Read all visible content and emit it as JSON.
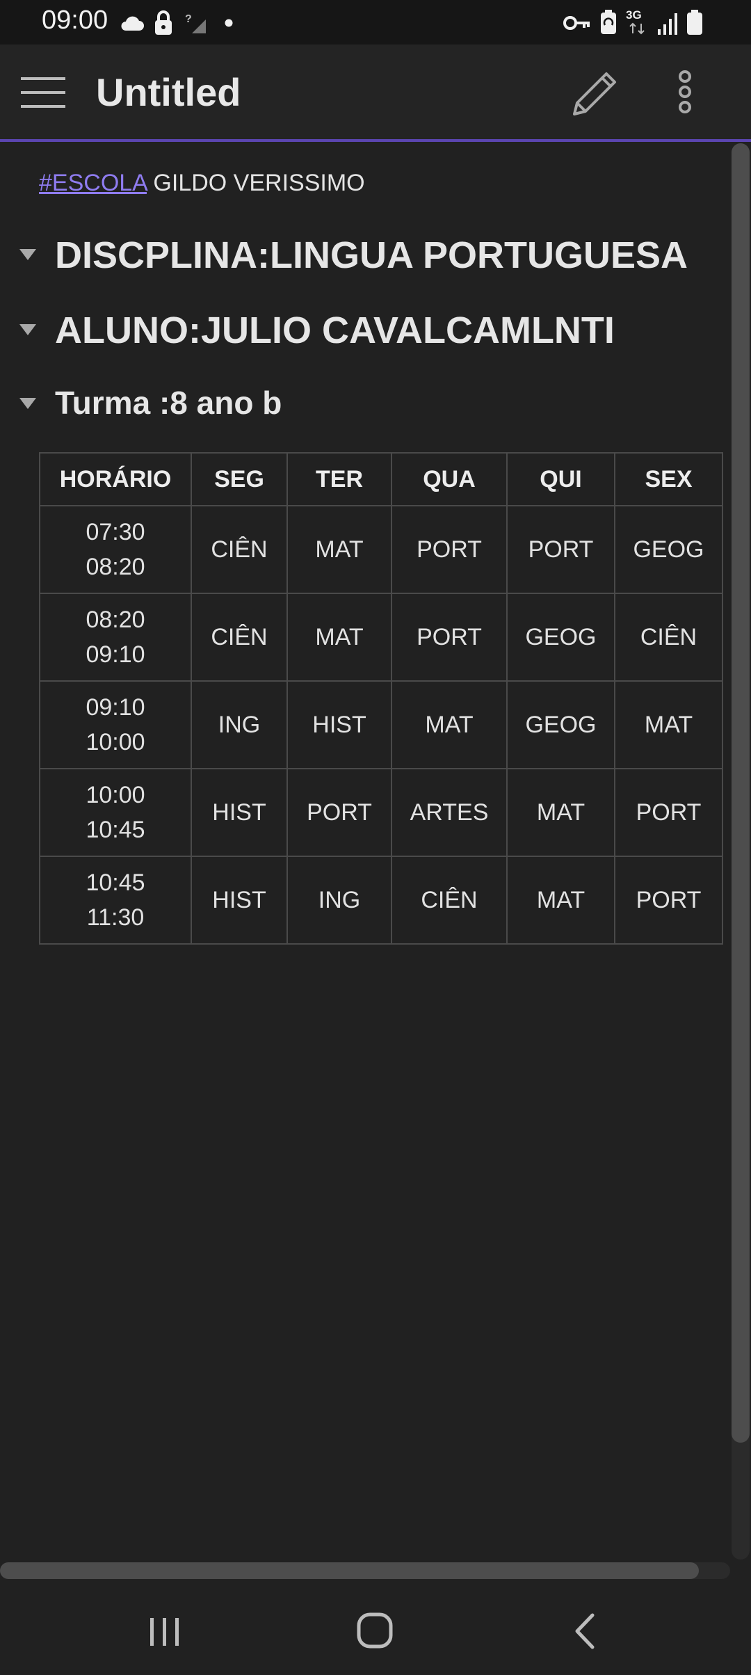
{
  "status_bar": {
    "time": "09:00",
    "left_icons": [
      "cloud-icon",
      "lock-icon",
      "no-signal-icon",
      "dot-icon"
    ],
    "right_icons": [
      "key-icon",
      "battery-saver-icon",
      "network-3g-icon",
      "signal-icon",
      "battery-icon"
    ],
    "network_label": "3G"
  },
  "app_bar": {
    "title": "Untitled",
    "accent_color": "#5b45b0"
  },
  "note": {
    "tag_link": "#ESCOLA",
    "tag_text": " GILDO VERISSIMO",
    "tag_color": "#8f7cf0",
    "headings": [
      {
        "level": 1,
        "text": "DISCPLINA:LINGUA PORTUGUESA"
      },
      {
        "level": 1,
        "text": "ALUNO:JULIO CAVALCAMLNTI"
      },
      {
        "level": 3,
        "text": "Turma :8 ano b"
      }
    ],
    "table": {
      "headers": [
        "HORÁRIO",
        "SEG",
        "TER",
        "QUA",
        "QUI",
        "SEX"
      ],
      "rows": [
        {
          "start": "07:30",
          "end": "08:20",
          "cells": [
            "CIÊN",
            "MAT",
            "PORT",
            "PORT",
            "GEOG"
          ]
        },
        {
          "start": "08:20",
          "end": "09:10",
          "cells": [
            "CIÊN",
            "MAT",
            "PORT",
            "GEOG",
            "CIÊN"
          ]
        },
        {
          "start": "09:10",
          "end": "10:00",
          "cells": [
            "ING",
            "HIST",
            "MAT",
            "GEOG",
            "MAT"
          ]
        },
        {
          "start": "10:00",
          "end": "10:45",
          "cells": [
            "HIST",
            "PORT",
            "ARTES",
            "MAT",
            "PORT"
          ]
        },
        {
          "start": "10:45",
          "end": "11:30",
          "cells": [
            "HIST",
            "ING",
            "CIÊN",
            "MAT",
            "PORT"
          ]
        }
      ]
    }
  },
  "nav_bar": {
    "buttons": [
      "recent-apps-icon",
      "home-icon",
      "back-icon"
    ]
  }
}
